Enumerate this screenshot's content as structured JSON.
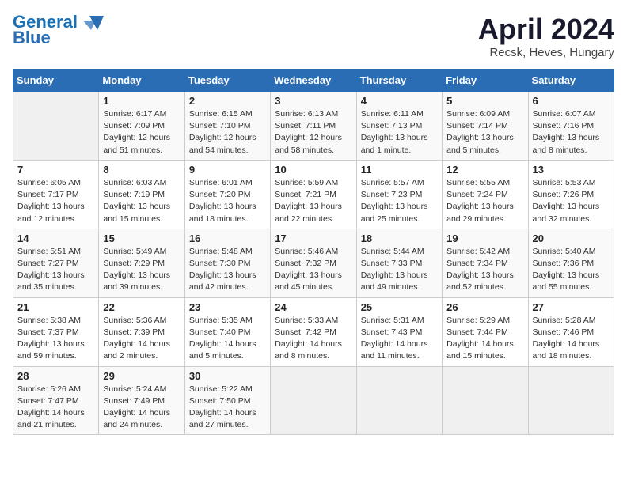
{
  "header": {
    "logo_line1": "General",
    "logo_line2": "Blue",
    "title": "April 2024",
    "subtitle": "Recsk, Heves, Hungary"
  },
  "calendar": {
    "days_of_week": [
      "Sunday",
      "Monday",
      "Tuesday",
      "Wednesday",
      "Thursday",
      "Friday",
      "Saturday"
    ],
    "weeks": [
      [
        {
          "day": "",
          "info": ""
        },
        {
          "day": "1",
          "info": "Sunrise: 6:17 AM\nSunset: 7:09 PM\nDaylight: 12 hours\nand 51 minutes."
        },
        {
          "day": "2",
          "info": "Sunrise: 6:15 AM\nSunset: 7:10 PM\nDaylight: 12 hours\nand 54 minutes."
        },
        {
          "day": "3",
          "info": "Sunrise: 6:13 AM\nSunset: 7:11 PM\nDaylight: 12 hours\nand 58 minutes."
        },
        {
          "day": "4",
          "info": "Sunrise: 6:11 AM\nSunset: 7:13 PM\nDaylight: 13 hours\nand 1 minute."
        },
        {
          "day": "5",
          "info": "Sunrise: 6:09 AM\nSunset: 7:14 PM\nDaylight: 13 hours\nand 5 minutes."
        },
        {
          "day": "6",
          "info": "Sunrise: 6:07 AM\nSunset: 7:16 PM\nDaylight: 13 hours\nand 8 minutes."
        }
      ],
      [
        {
          "day": "7",
          "info": "Sunrise: 6:05 AM\nSunset: 7:17 PM\nDaylight: 13 hours\nand 12 minutes."
        },
        {
          "day": "8",
          "info": "Sunrise: 6:03 AM\nSunset: 7:19 PM\nDaylight: 13 hours\nand 15 minutes."
        },
        {
          "day": "9",
          "info": "Sunrise: 6:01 AM\nSunset: 7:20 PM\nDaylight: 13 hours\nand 18 minutes."
        },
        {
          "day": "10",
          "info": "Sunrise: 5:59 AM\nSunset: 7:21 PM\nDaylight: 13 hours\nand 22 minutes."
        },
        {
          "day": "11",
          "info": "Sunrise: 5:57 AM\nSunset: 7:23 PM\nDaylight: 13 hours\nand 25 minutes."
        },
        {
          "day": "12",
          "info": "Sunrise: 5:55 AM\nSunset: 7:24 PM\nDaylight: 13 hours\nand 29 minutes."
        },
        {
          "day": "13",
          "info": "Sunrise: 5:53 AM\nSunset: 7:26 PM\nDaylight: 13 hours\nand 32 minutes."
        }
      ],
      [
        {
          "day": "14",
          "info": "Sunrise: 5:51 AM\nSunset: 7:27 PM\nDaylight: 13 hours\nand 35 minutes."
        },
        {
          "day": "15",
          "info": "Sunrise: 5:49 AM\nSunset: 7:29 PM\nDaylight: 13 hours\nand 39 minutes."
        },
        {
          "day": "16",
          "info": "Sunrise: 5:48 AM\nSunset: 7:30 PM\nDaylight: 13 hours\nand 42 minutes."
        },
        {
          "day": "17",
          "info": "Sunrise: 5:46 AM\nSunset: 7:32 PM\nDaylight: 13 hours\nand 45 minutes."
        },
        {
          "day": "18",
          "info": "Sunrise: 5:44 AM\nSunset: 7:33 PM\nDaylight: 13 hours\nand 49 minutes."
        },
        {
          "day": "19",
          "info": "Sunrise: 5:42 AM\nSunset: 7:34 PM\nDaylight: 13 hours\nand 52 minutes."
        },
        {
          "day": "20",
          "info": "Sunrise: 5:40 AM\nSunset: 7:36 PM\nDaylight: 13 hours\nand 55 minutes."
        }
      ],
      [
        {
          "day": "21",
          "info": "Sunrise: 5:38 AM\nSunset: 7:37 PM\nDaylight: 13 hours\nand 59 minutes."
        },
        {
          "day": "22",
          "info": "Sunrise: 5:36 AM\nSunset: 7:39 PM\nDaylight: 14 hours\nand 2 minutes."
        },
        {
          "day": "23",
          "info": "Sunrise: 5:35 AM\nSunset: 7:40 PM\nDaylight: 14 hours\nand 5 minutes."
        },
        {
          "day": "24",
          "info": "Sunrise: 5:33 AM\nSunset: 7:42 PM\nDaylight: 14 hours\nand 8 minutes."
        },
        {
          "day": "25",
          "info": "Sunrise: 5:31 AM\nSunset: 7:43 PM\nDaylight: 14 hours\nand 11 minutes."
        },
        {
          "day": "26",
          "info": "Sunrise: 5:29 AM\nSunset: 7:44 PM\nDaylight: 14 hours\nand 15 minutes."
        },
        {
          "day": "27",
          "info": "Sunrise: 5:28 AM\nSunset: 7:46 PM\nDaylight: 14 hours\nand 18 minutes."
        }
      ],
      [
        {
          "day": "28",
          "info": "Sunrise: 5:26 AM\nSunset: 7:47 PM\nDaylight: 14 hours\nand 21 minutes."
        },
        {
          "day": "29",
          "info": "Sunrise: 5:24 AM\nSunset: 7:49 PM\nDaylight: 14 hours\nand 24 minutes."
        },
        {
          "day": "30",
          "info": "Sunrise: 5:22 AM\nSunset: 7:50 PM\nDaylight: 14 hours\nand 27 minutes."
        },
        {
          "day": "",
          "info": ""
        },
        {
          "day": "",
          "info": ""
        },
        {
          "day": "",
          "info": ""
        },
        {
          "day": "",
          "info": ""
        }
      ]
    ]
  }
}
